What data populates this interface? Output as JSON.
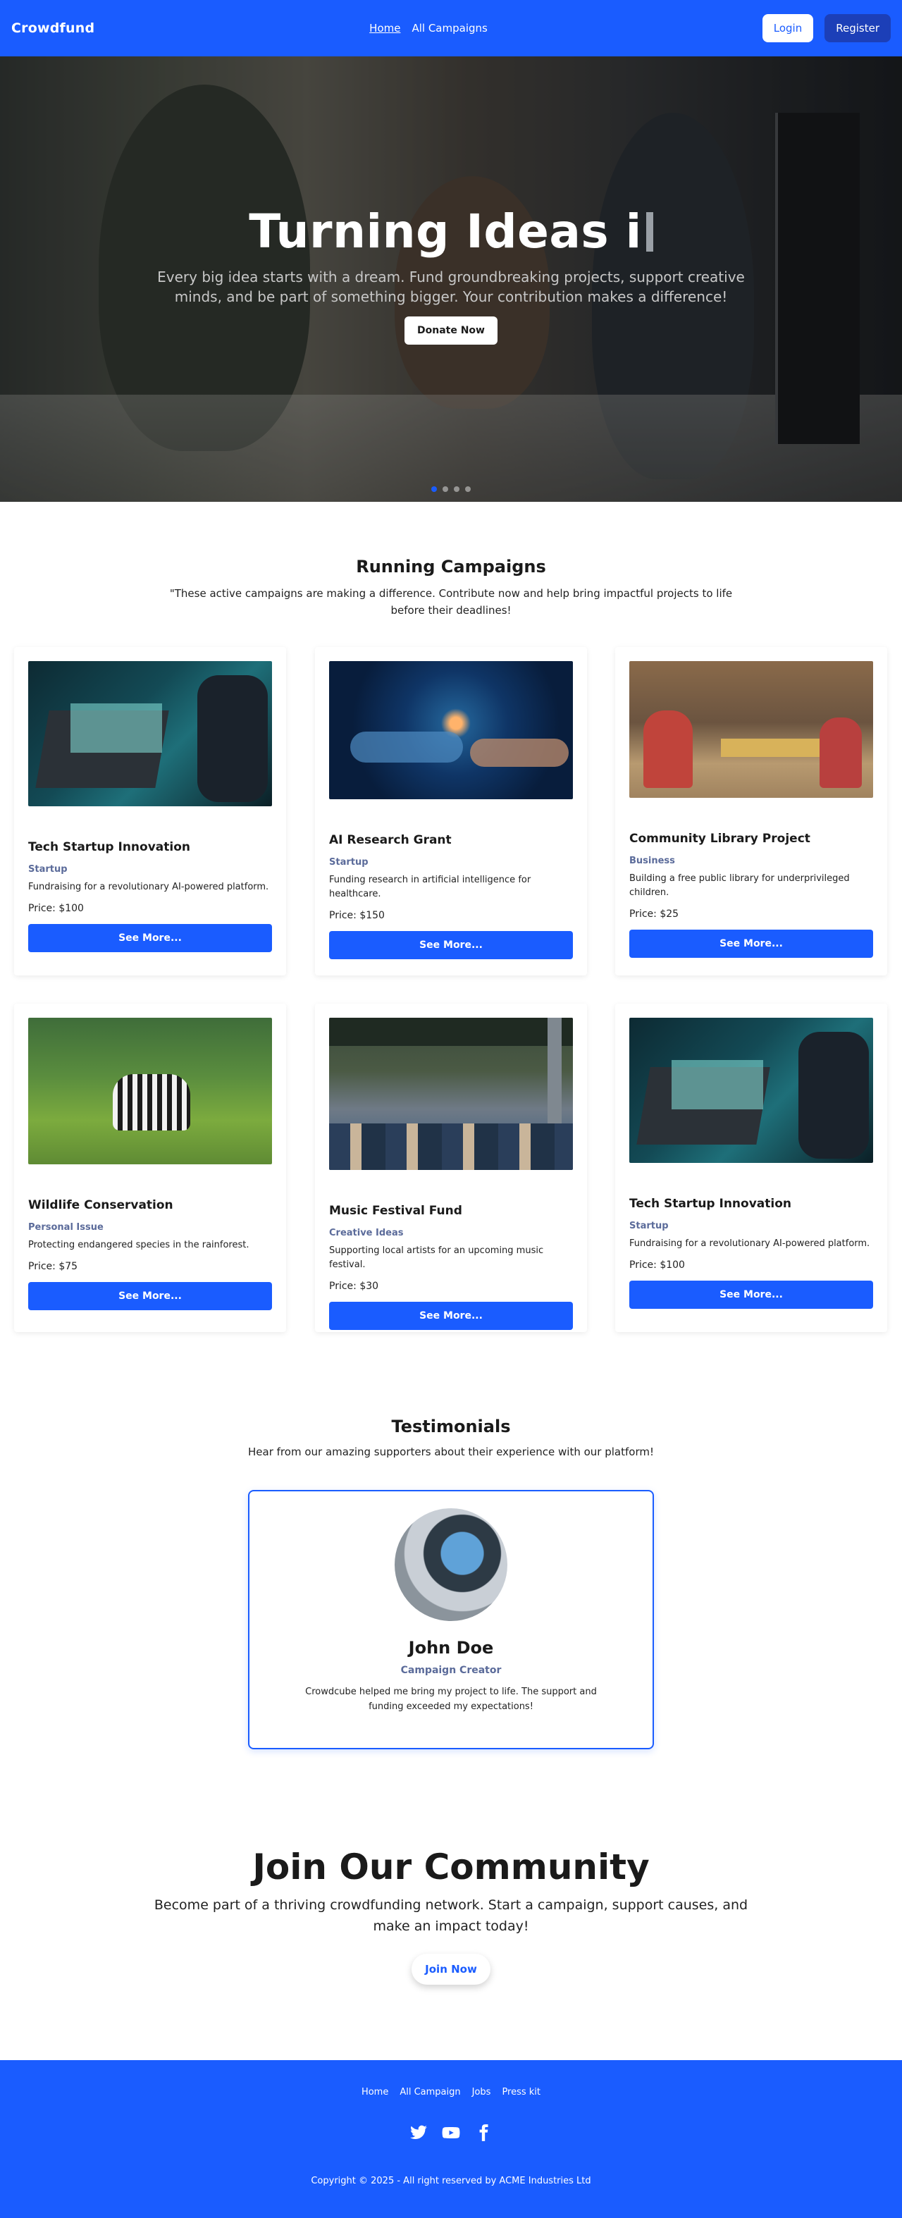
{
  "navbar": {
    "brand": "Crowdfund",
    "links": [
      "Home",
      "All Campaigns"
    ],
    "login": "Login",
    "register": "Register"
  },
  "hero": {
    "title": "Turning Ideas i",
    "subtitle": "Every big idea starts with a dream. Fund groundbreaking projects, support creative minds, and be part of something bigger. Your contribution makes a difference!",
    "button": "Donate Now",
    "active_slide": 1,
    "slide_count": 4
  },
  "running": {
    "title": "Running Campaigns",
    "description": "\"These active campaigns are making a difference. Contribute now and help bring impactful projects to life before their deadlines!"
  },
  "campaigns": [
    {
      "title": "Tech Startup Innovation",
      "category": "Startup",
      "description": "Fundraising for a revolutionary AI-powered platform.",
      "price": "Price: $100",
      "button": "See More..."
    },
    {
      "title": "AI Research Grant",
      "category": "Startup",
      "description": "Funding research in artificial intelligence for healthcare.",
      "price": "Price: $150",
      "button": "See More..."
    },
    {
      "title": "Community Library Project",
      "category": "Business",
      "description": "Building a free public library for underprivileged children.",
      "price": "Price: $25",
      "button": "See More..."
    },
    {
      "title": "Wildlife Conservation",
      "category": "Personal Issue",
      "description": "Protecting endangered species in the rainforest.",
      "price": "Price: $75",
      "button": "See More..."
    },
    {
      "title": "Music Festival Fund",
      "category": "Creative Ideas",
      "description": "Supporting local artists for an upcoming music festival.",
      "price": "Price: $30",
      "button": "See More..."
    },
    {
      "title": "Tech Startup Innovation",
      "category": "Startup",
      "description": "Fundraising for a revolutionary AI-powered platform.",
      "price": "Price: $100",
      "button": "See More..."
    }
  ],
  "testimonials": {
    "title": "Testimonials",
    "description": "Hear from our amazing supporters about their experience with our platform!",
    "name": "John Doe",
    "role": "Campaign Creator",
    "quote": "Crowdcube helped me bring my project to life. The support and funding exceeded my expectations!"
  },
  "community": {
    "title": "Join Our Community",
    "description": "Become part of a thriving crowdfunding network. Start a campaign, support causes, and make an impact today!",
    "button": "Join Now"
  },
  "footer": {
    "links": [
      "Home",
      "All Campaign",
      "Jobs",
      "Press kit"
    ],
    "social": [
      "twitter-icon",
      "youtube-icon",
      "facebook-icon"
    ],
    "copyright": "Copyright © 2025 - All right reserved by ACME Industries Ltd"
  },
  "colors": {
    "primary": "#1a5cff",
    "register": "#1c3fb8",
    "category": "#5b6b9a"
  }
}
